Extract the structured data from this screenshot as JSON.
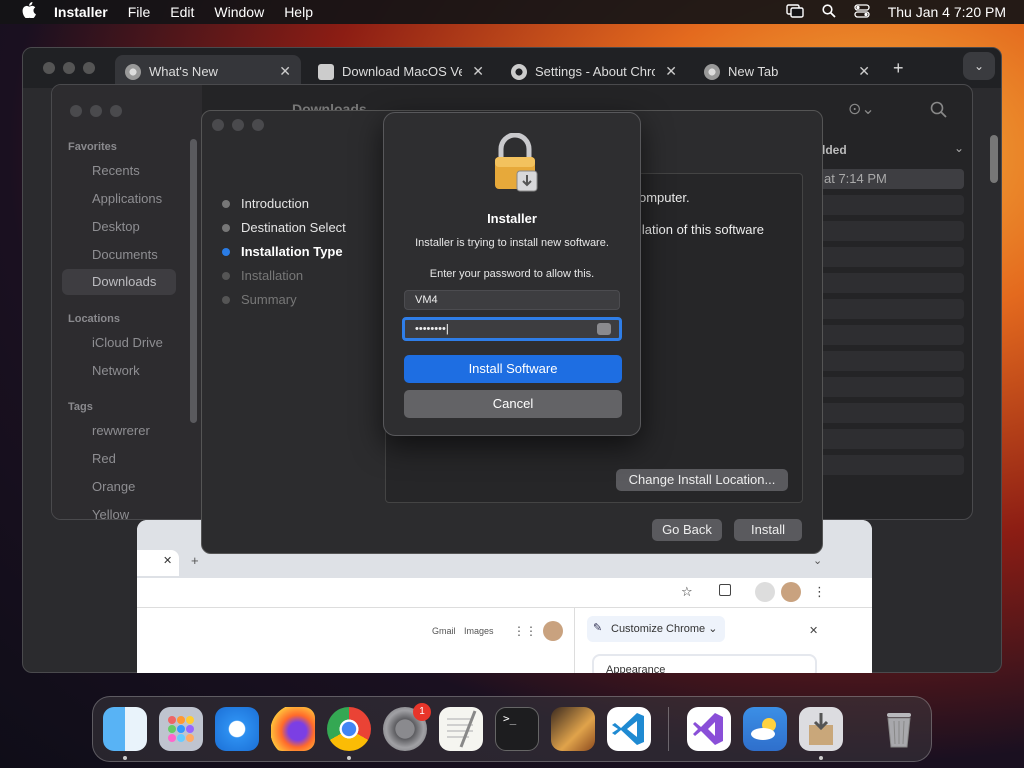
{
  "menubar": {
    "app": "Installer",
    "items": [
      "File",
      "Edit",
      "Window",
      "Help"
    ],
    "clock": "Thu Jan 4  7:20 PM"
  },
  "chrome": {
    "tabs": [
      {
        "label": "What's New",
        "icon": "chrome-icon"
      },
      {
        "label": "Download MacOS Ve",
        "icon": "download-site-icon"
      },
      {
        "label": "Settings - About Chro",
        "icon": "settings-gear-icon"
      },
      {
        "label": "New Tab",
        "icon": "chrome-icon"
      }
    ],
    "newtab": "+",
    "links": {
      "gmail": "Gmail",
      "images": "Images"
    },
    "customize": "Customize Chrome",
    "appearance": "Appearance"
  },
  "finder": {
    "title": "Downloads",
    "sections": {
      "favorites": "Favorites",
      "locations": "Locations",
      "tags": "Tags"
    },
    "favorites": [
      "Recents",
      "Applications",
      "Desktop",
      "Documents",
      "Downloads"
    ],
    "locations": [
      "iCloud Drive",
      "Network"
    ],
    "tags": [
      "rewwrerer",
      "Red",
      "Orange",
      "Yellow"
    ],
    "column_header": "dded",
    "first_row": "at 7:14 PM"
  },
  "installer": {
    "steps": [
      {
        "label": "Introduction",
        "state": "done"
      },
      {
        "label": "Destination Select",
        "state": "done"
      },
      {
        "label": "Installation Type",
        "state": "current"
      },
      {
        "label": "Installation",
        "state": "future"
      },
      {
        "label": "Summary",
        "state": "future"
      }
    ],
    "content_line1": "omputer.",
    "content_line2": "llation of this software",
    "change_location": "Change Install Location...",
    "go_back": "Go Back",
    "install": "Install"
  },
  "dialog": {
    "title": "Installer",
    "message": "Installer is trying to install new software.",
    "prompt": "Enter your password to allow this.",
    "username": "VM4",
    "password_mask": "••••••••",
    "primary": "Install Software",
    "secondary": "Cancel"
  },
  "dock": {
    "apps": [
      "Finder",
      "Launchpad",
      "Safari",
      "Firefox",
      "Chrome",
      "System Settings",
      "TextEdit",
      "Terminal",
      "GarageBand",
      "VS Code",
      "Visual Studio",
      "Weather",
      "Installer",
      "Trash"
    ],
    "settings_badge": "1"
  }
}
